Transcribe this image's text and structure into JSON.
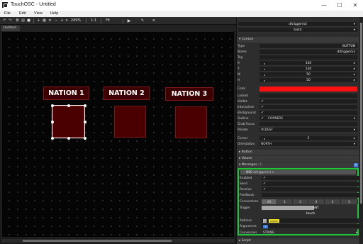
{
  "window": {
    "title": "TouchOSC - Untitled",
    "minimize": "—",
    "maximize": "☐",
    "close": "✕"
  },
  "menu": [
    "File",
    "Edit",
    "View",
    "Help"
  ],
  "toolbar": {
    "zoom": "249%",
    "ratio": "1:1",
    "fit": "Fit"
  },
  "doc_tab": "Untitled",
  "canvas": {
    "labels": [
      "NATION 1",
      "NATION 2",
      "NATION 3"
    ]
  },
  "panel": {
    "top_rows": [
      {
        "value": "d/trigger/n3"
      },
      {
        "value": "text4"
      }
    ],
    "control_section": "Control",
    "props": [
      {
        "key": "Type",
        "value": "BUTTON"
      },
      {
        "key": "Name",
        "value": "d/trigger/n3"
      },
      {
        "key": "Tag",
        "value": ""
      },
      {
        "key": "X",
        "value": "140"
      },
      {
        "key": "Y",
        "value": "130"
      },
      {
        "key": "W",
        "value": "50"
      },
      {
        "key": "H",
        "value": "50"
      }
    ],
    "color_key": "Color",
    "color_value": "#ff1010",
    "flags": [
      {
        "key": "Locked",
        "checked": false
      },
      {
        "key": "Visible",
        "checked": true
      },
      {
        "key": "Interactive",
        "checked": true
      },
      {
        "key": "Background",
        "checked": true
      },
      {
        "key": "Outline",
        "checked": true
      }
    ],
    "outline_style": "CORNERS",
    "grab_focus_key": "Grab Focus",
    "pointer_key": "Pointer",
    "pointer_value": "OLDEST",
    "corner_key": "Corner",
    "corner_value": "2",
    "orientation_key": "Orientation",
    "orientation_value": "NORTH",
    "sections": {
      "button": "Button",
      "values": "Values",
      "messages": "Messages",
      "messages_count": "(1)",
      "script": "Script"
    },
    "osc": {
      "header": "OSC",
      "header_path": "d/trigger/n3 a",
      "rows": [
        {
          "key": "Enabled",
          "checked": true
        },
        {
          "key": "Send",
          "checked": true
        },
        {
          "key": "Receive",
          "checked": true
        },
        {
          "key": "Feedback",
          "checked": false
        }
      ],
      "connections_key": "Connections",
      "connections": [
        "All",
        "1",
        "2",
        "3",
        "4",
        "5"
      ],
      "trigger_key": "Trigger",
      "trigger_value": "ANY",
      "trigger_sub": "touch",
      "address_key": "Address",
      "address_tag": "name",
      "arguments_key": "Arguments",
      "arguments_add": "+",
      "conversion_key": "Conversion",
      "conversion_value": "STRING"
    }
  }
}
